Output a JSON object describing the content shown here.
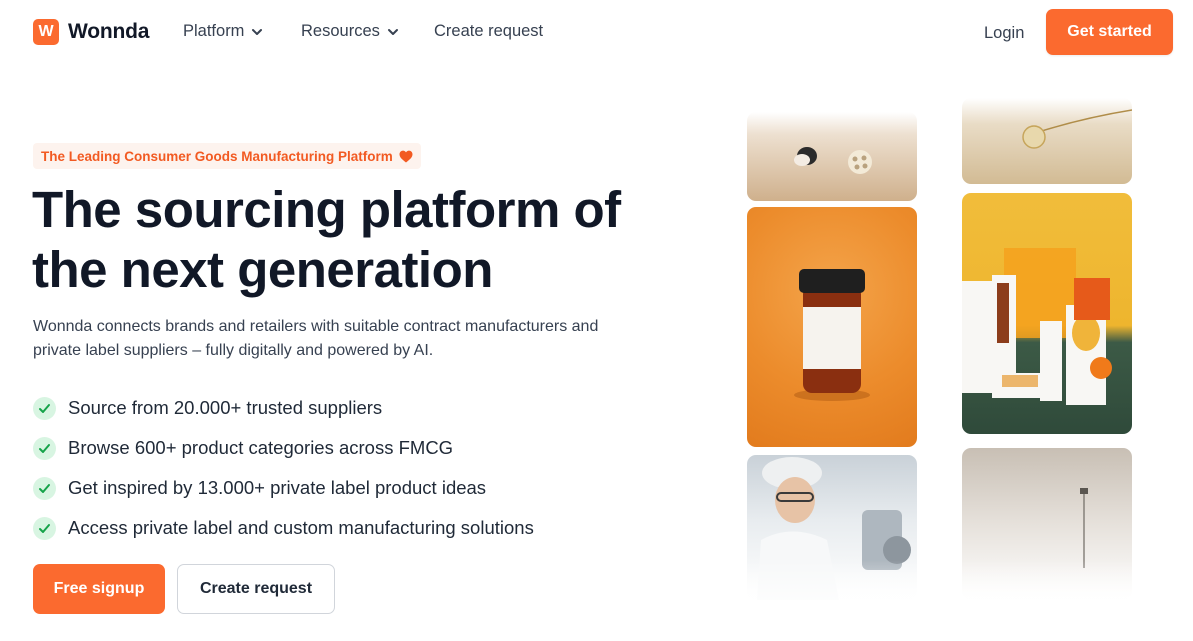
{
  "brand": {
    "logo_letter": "W",
    "name": "Wonnda",
    "accent_color": "#fb6a2f"
  },
  "nav": {
    "items": [
      {
        "label": "Platform",
        "icon": "chevron-down-icon"
      },
      {
        "label": "Resources",
        "icon": "chevron-down-icon"
      },
      {
        "label": "Create request"
      }
    ],
    "login_label": "Login",
    "cta_label": "Get started"
  },
  "hero": {
    "badge": {
      "text": "The Leading Consumer Goods Manufacturing Platform",
      "icon": "heart-icon"
    },
    "headline": [
      "The sourcing platform of",
      "the next generation"
    ],
    "subtitle": "Wonnda connects brands and retailers with suitable contract manufacturers and private label suppliers – fully digitally and powered by AI.",
    "features": [
      "Source from 20.000+ trusted suppliers",
      "Browse 600+ product categories across FMCG",
      "Get inspired by 13.000+ private label product ideas",
      "Access private label and custom manufacturing solutions"
    ],
    "primary_button": "Free signup",
    "secondary_button": "Create request"
  },
  "gallery": {
    "images": [
      "snack-image",
      "supplement-jar-image",
      "factory-worker-image",
      "necklace-image",
      "packaging-boxes-image",
      "lab-equipment-image"
    ]
  }
}
